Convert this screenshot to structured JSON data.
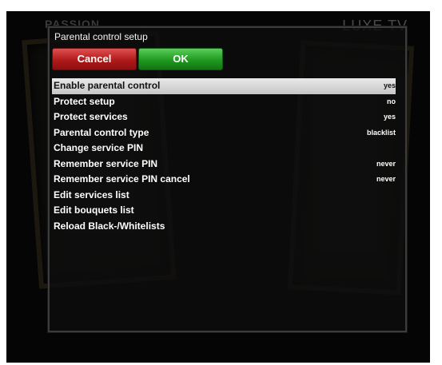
{
  "channel": {
    "left_logo": "PASSION",
    "right_logo": "LUXE TV"
  },
  "dialog": {
    "title": "Parental control setup",
    "buttons": {
      "cancel": "Cancel",
      "ok": "OK"
    },
    "items": [
      {
        "label": "Enable parental control",
        "value": "yes"
      },
      {
        "label": "Protect setup",
        "value": "no"
      },
      {
        "label": "Protect services",
        "value": "yes"
      },
      {
        "label": "Parental control type",
        "value": "blacklist"
      },
      {
        "label": "Change service PIN",
        "value": ""
      },
      {
        "label": "Remember service PIN",
        "value": "never"
      },
      {
        "label": "Remember service PIN cancel",
        "value": "never"
      },
      {
        "label": "Edit services list",
        "value": ""
      },
      {
        "label": "Edit bouquets list",
        "value": ""
      },
      {
        "label": "Reload Black-/Whitelists",
        "value": ""
      }
    ],
    "selected_index": 0
  },
  "colors": {
    "cancel_button": "#b01a1a",
    "ok_button": "#1f9a1f",
    "selection": "#d8d8d8"
  }
}
